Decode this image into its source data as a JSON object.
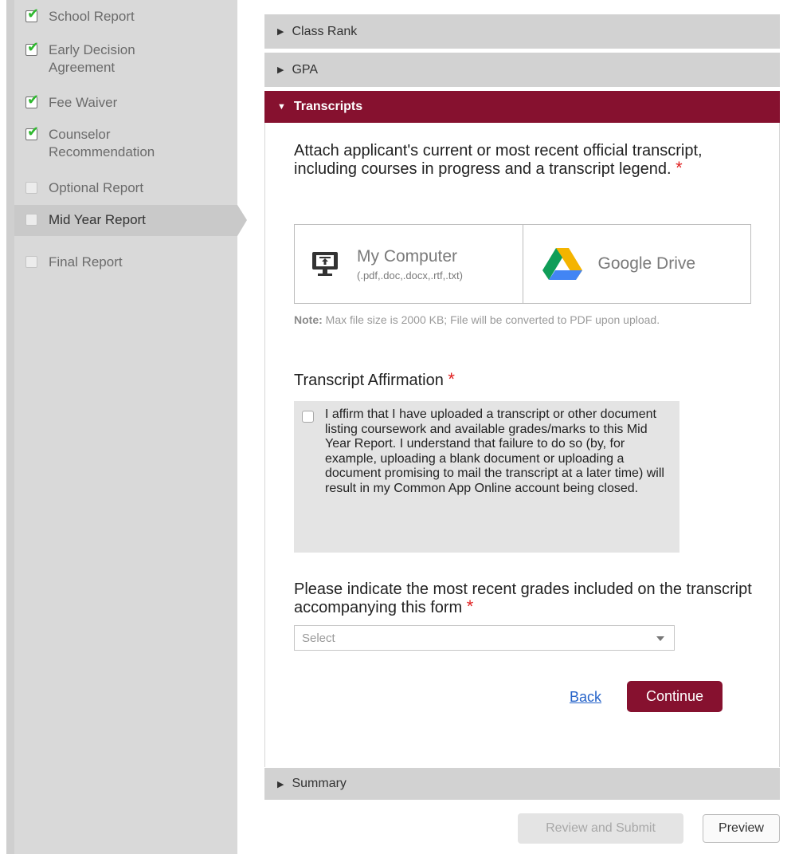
{
  "sidebar": {
    "items": [
      {
        "label": "School Report",
        "checked": true
      },
      {
        "label": "Early Decision\nAgreement",
        "checked": true
      },
      {
        "label": "Fee Waiver",
        "checked": true
      },
      {
        "label": "Counselor\nRecommendation",
        "checked": true
      },
      {
        "label": "Optional Report",
        "checked": false
      },
      {
        "label": "Mid Year Report",
        "checked": false,
        "active": true
      },
      {
        "label": "Final Report",
        "checked": false
      }
    ],
    "check_color": "#2eb82e"
  },
  "sections": {
    "class_rank": "Class Rank",
    "gpa": "GPA",
    "transcripts": "Transcripts",
    "summary": "Summary"
  },
  "transcripts": {
    "attach_prompt": "Attach applicant's current or most recent official transcript, including courses in progress and a transcript legend.",
    "required_mark": "*",
    "upload": {
      "my_computer": "My Computer",
      "my_computer_types": "(.pdf,.doc,.docx,.rtf,.txt)",
      "google_drive": "Google Drive"
    },
    "note_label": "Note:",
    "note_text": "Max file size is 2000 KB; File will be converted to PDF upon upload.",
    "affirmation_label": "Transcript Affirmation",
    "affirmation_text": "I affirm that I have uploaded a transcript or other document listing coursework and available grades/marks to this Mid Year Report. I understand that failure to do so (by, for example, uploading a blank document or uploading a document promising to mail the transcript at a later time) will result in my Common App Online account being closed.",
    "grades_label": "Please indicate the most recent grades included on the transcript accompanying this form",
    "grades_select_placeholder": "Select",
    "back": "Back",
    "continue": "Continue"
  },
  "footer": {
    "review_submit": "Review and Submit",
    "preview": "Preview"
  },
  "colors": {
    "accent": "#86112f",
    "link": "#2563c9",
    "required": "#e02020"
  }
}
